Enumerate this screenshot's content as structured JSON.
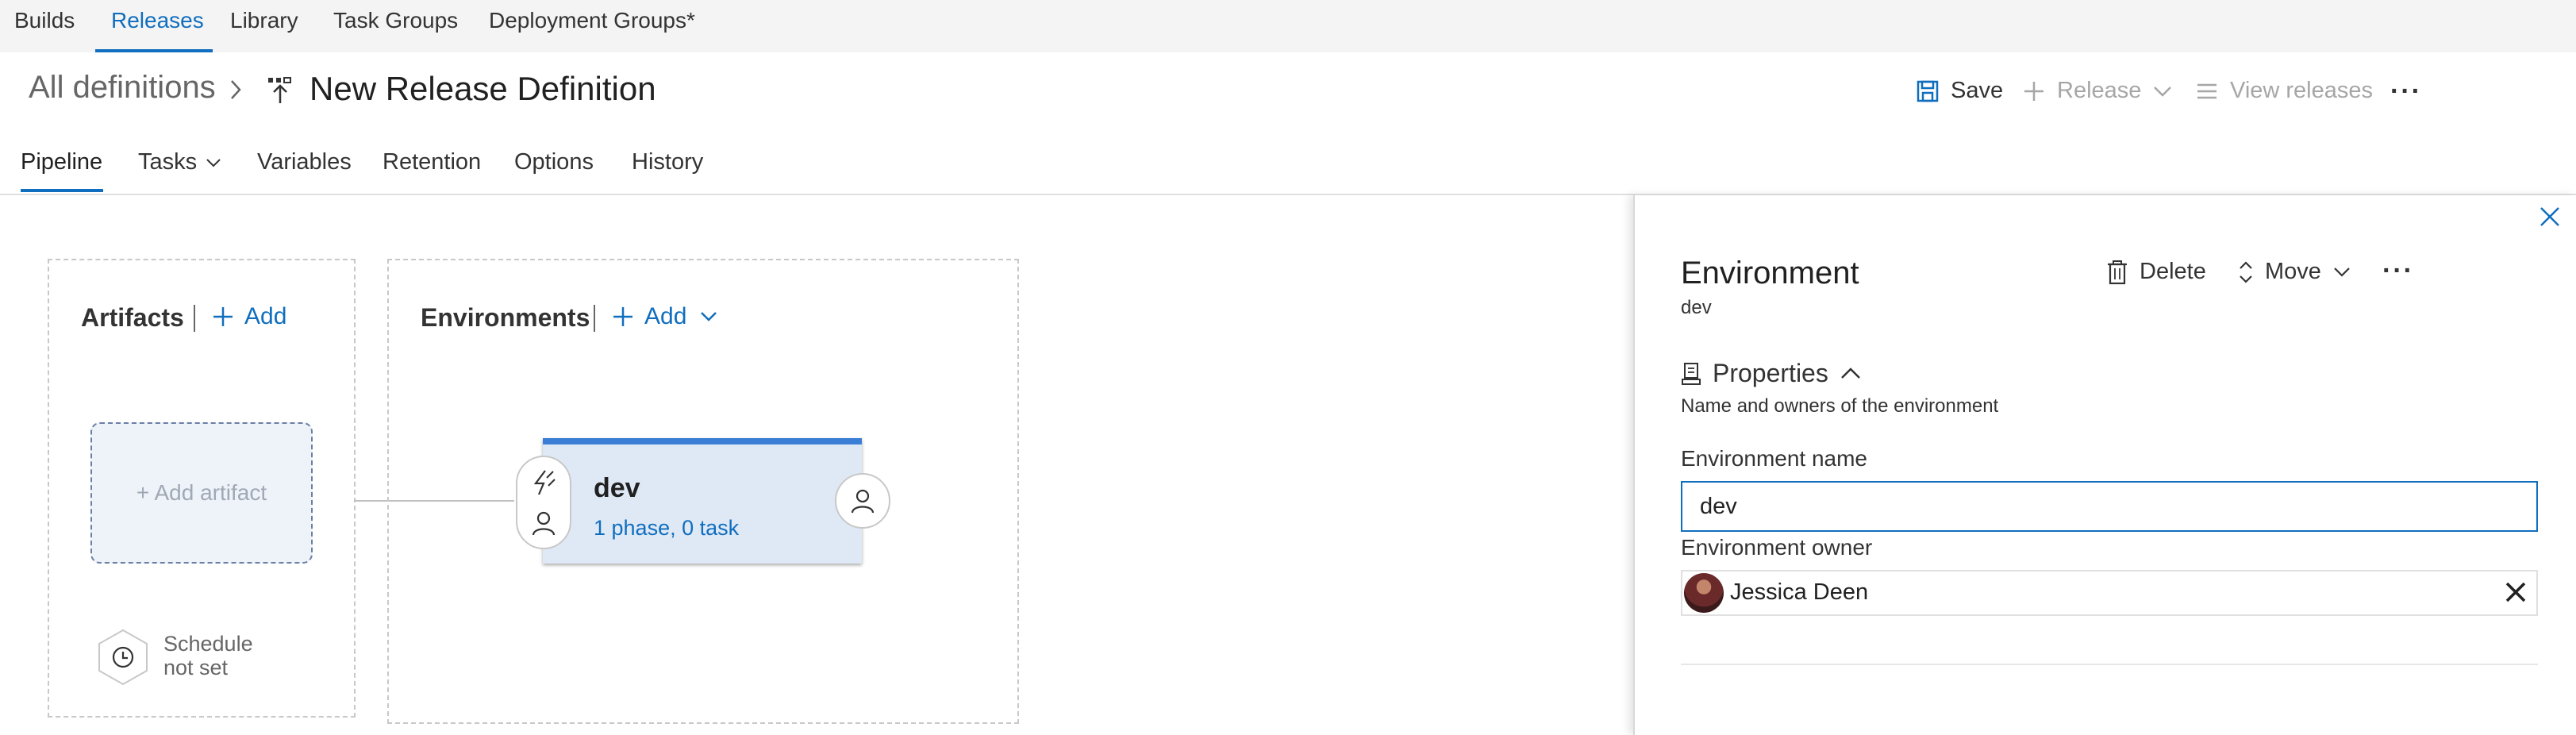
{
  "topnav": {
    "items": [
      "Builds",
      "Releases",
      "Library",
      "Task Groups",
      "Deployment Groups*"
    ],
    "active_index": 1
  },
  "header": {
    "breadcrumb_root": "All definitions",
    "title": "New Release Definition",
    "save_label": "Save",
    "release_label": "Release",
    "view_releases_label": "View releases",
    "more_label": "···"
  },
  "tabs": {
    "items": [
      "Pipeline",
      "Tasks",
      "Variables",
      "Retention",
      "Options",
      "History"
    ],
    "active_index": 0
  },
  "pipeline": {
    "artifacts_heading": "Artifacts",
    "artifacts_add_label": "Add",
    "add_artifact_label": "+ Add artifact",
    "schedule_line1": "Schedule",
    "schedule_line2": "not set",
    "environments_heading": "Environments",
    "environments_add_label": "Add",
    "environment_card": {
      "name": "dev",
      "summary": "1 phase, 0 task"
    }
  },
  "panel": {
    "title": "Environment",
    "subtitle": "dev",
    "delete_label": "Delete",
    "move_label": "Move",
    "more_label": "···",
    "properties_heading": "Properties",
    "properties_description": "Name and owners of the environment",
    "env_name_label": "Environment name",
    "env_name_value": "dev",
    "env_owner_label": "Environment owner",
    "env_owner_value": "Jessica Deen"
  },
  "colors": {
    "accent": "#106ebe",
    "card_top": "#3a7fd5",
    "card_bg": "#dfe9f5"
  }
}
